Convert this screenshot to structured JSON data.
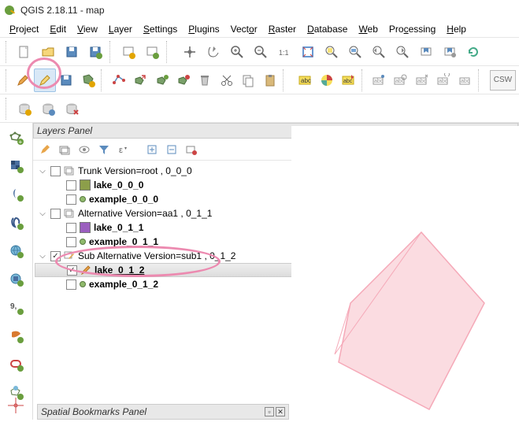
{
  "title": "QGIS 2.18.11 - map",
  "menus": [
    "Project",
    "Edit",
    "View",
    "Layer",
    "Settings",
    "Plugins",
    "Vector",
    "Raster",
    "Database",
    "Web",
    "Processing",
    "Help"
  ],
  "panels": {
    "layers": {
      "title": "Layers Panel"
    },
    "bookmarks": {
      "title": "Spatial Bookmarks Panel"
    }
  },
  "layer_tree": {
    "groups": [
      {
        "label": "Trunk Version=root , 0_0_0",
        "checked": false,
        "children": [
          {
            "type": "poly",
            "label": "lake_0_0_0",
            "color": "#8c9e4a",
            "checked": false,
            "bold": true
          },
          {
            "type": "point",
            "label": "example_0_0_0",
            "checked": false,
            "bold": true
          }
        ]
      },
      {
        "label": "Alternative Version=aa1 , 0_1_1",
        "checked": false,
        "children": [
          {
            "type": "poly",
            "label": "lake_0_1_1",
            "color": "#9b5fbf",
            "checked": false,
            "bold": true
          },
          {
            "type": "point",
            "label": "example_0_1_1",
            "checked": false,
            "bold": true
          }
        ]
      },
      {
        "label": "Sub Alternative Version=sub1 , 0_1_2",
        "checked": true,
        "editable": true,
        "children": [
          {
            "type": "poly",
            "label": "lake_0_1_2",
            "color": "#f9c8d1",
            "checked": true,
            "bold": true,
            "selected": true,
            "editing": true,
            "underline": true
          },
          {
            "type": "point",
            "label": "example_0_1_2",
            "checked": false,
            "bold": true
          }
        ]
      }
    ]
  },
  "csw_button": "CSW"
}
